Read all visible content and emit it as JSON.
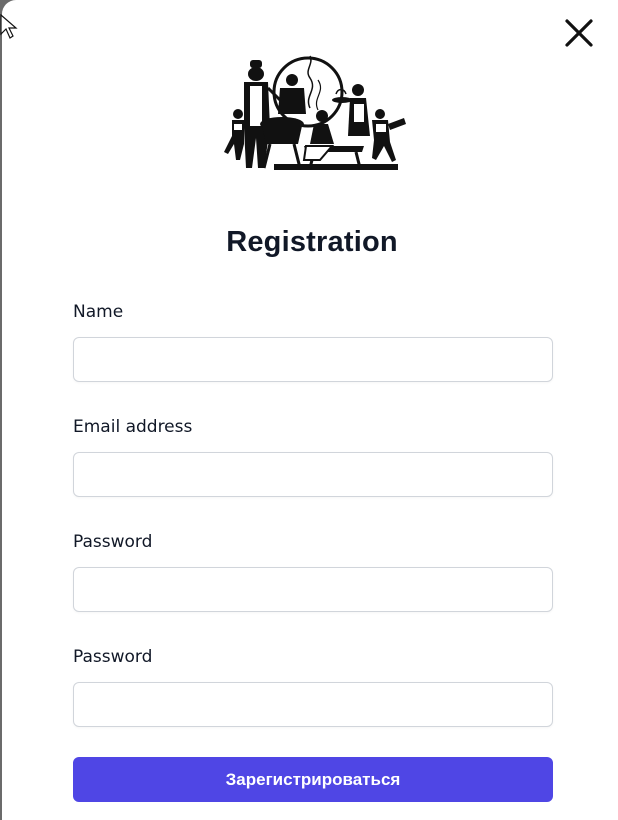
{
  "modal": {
    "title": "Registration",
    "close_icon": "close-icon",
    "logo_icon": "bbq-family-silhouette-logo"
  },
  "form": {
    "fields": [
      {
        "label": "Name",
        "value": "",
        "placeholder": ""
      },
      {
        "label": "Email address",
        "value": "",
        "placeholder": ""
      },
      {
        "label": "Password",
        "value": "",
        "placeholder": ""
      },
      {
        "label": "Password",
        "value": "",
        "placeholder": ""
      }
    ],
    "submit_label": "Зарегистрироваться"
  },
  "colors": {
    "accent": "#4f46e5",
    "title": "#111827",
    "input_border": "#d1d5db"
  }
}
